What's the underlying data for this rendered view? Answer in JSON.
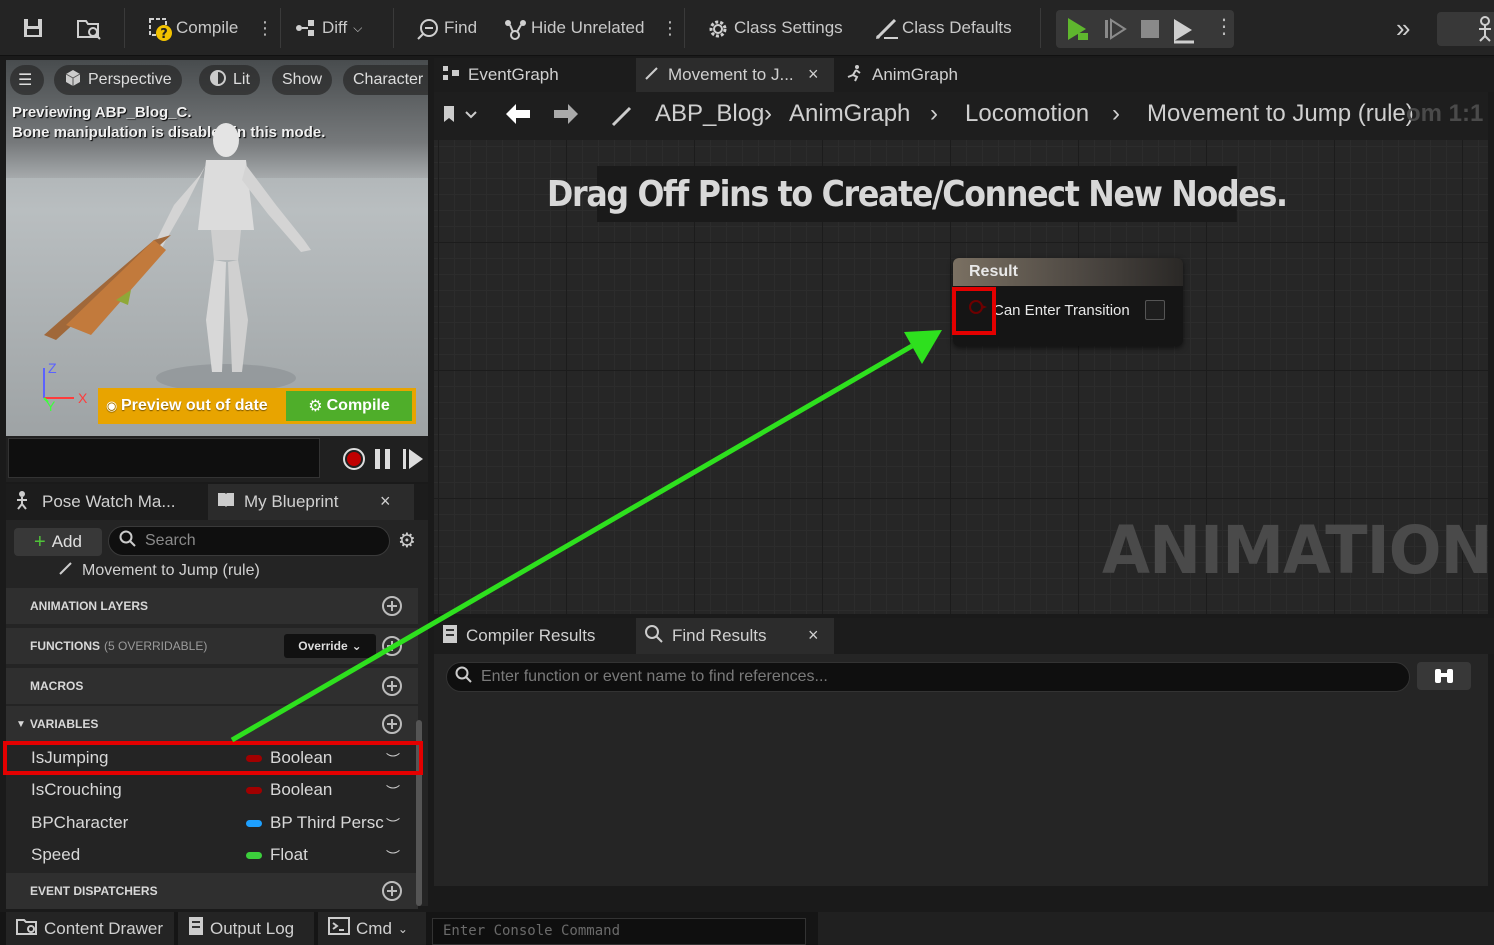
{
  "toolbar": {
    "compile_label": "Compile",
    "diff_label": "Diff",
    "find_label": "Find",
    "hide_unrelated_label": "Hide Unrelated",
    "class_settings_label": "Class Settings",
    "class_defaults_label": "Class Defaults"
  },
  "viewport": {
    "perspective_label": "Perspective",
    "lit_label": "Lit",
    "show_label": "Show",
    "character_label": "Character",
    "message_line1": "Previewing ABP_Blog_C.",
    "message_line2": "Bone manipulation is disabled in this mode.",
    "preview_out_of_date": "Preview out of date",
    "compile_label": "Compile",
    "axis_z": "Z",
    "axis_x": "X",
    "axis_y": "Y"
  },
  "left_tabs": {
    "pose_watch": "Pose Watch Ma...",
    "my_blueprint": "My Blueprint",
    "close": "×"
  },
  "my_blueprint": {
    "add_label": "Add",
    "search_placeholder": "Search",
    "current_item": "Movement to Jump (rule)",
    "sections": {
      "animation_layers": "ANIMATION LAYERS",
      "functions": "FUNCTIONS",
      "functions_sub": "(5 OVERRIDABLE)",
      "override_label": "Override",
      "macros": "MACROS",
      "variables": "VARIABLES",
      "event_dispatchers": "EVENT DISPATCHERS"
    },
    "variables": [
      {
        "name": "IsJumping",
        "type": "Boolean",
        "color": "#a10000"
      },
      {
        "name": "IsCrouching",
        "type": "Boolean",
        "color": "#a10000"
      },
      {
        "name": "BPCharacter",
        "type": "BP Third Persc",
        "color": "#1ea0ff"
      },
      {
        "name": "Speed",
        "type": "Float",
        "color": "#3ccf3c"
      }
    ]
  },
  "graph_tabs": {
    "event_graph": "EventGraph",
    "movement_tab": "Movement to J...",
    "close": "×",
    "anim_graph": "AnimGraph"
  },
  "breadcrumb": {
    "item1": "ABP_Blog",
    "item2": "AnimGraph",
    "item3": "Locomotion",
    "item4": "Movement to Jump (rule)",
    "zoom": "om 1:1"
  },
  "graph": {
    "banner": "Drag Off Pins to Create/Connect New Nodes.",
    "watermark": "ANIMATION",
    "node_title": "Result",
    "node_pin_label": "Can Enter Transition"
  },
  "results": {
    "compiler_results": "Compiler Results",
    "find_results": "Find Results",
    "close": "×",
    "search_placeholder": "Enter function or event name to find references..."
  },
  "status_bar": {
    "content_drawer": "Content Drawer",
    "output_log": "Output Log",
    "cmd": "Cmd",
    "console_placeholder": "Enter Console Command"
  },
  "colors": {
    "highlight_red": "#e40000",
    "arrow_green": "#2ee01e",
    "bool_pin": "#a10000",
    "preview_warning": "#e8a400",
    "compile_green": "#4fae2a"
  }
}
